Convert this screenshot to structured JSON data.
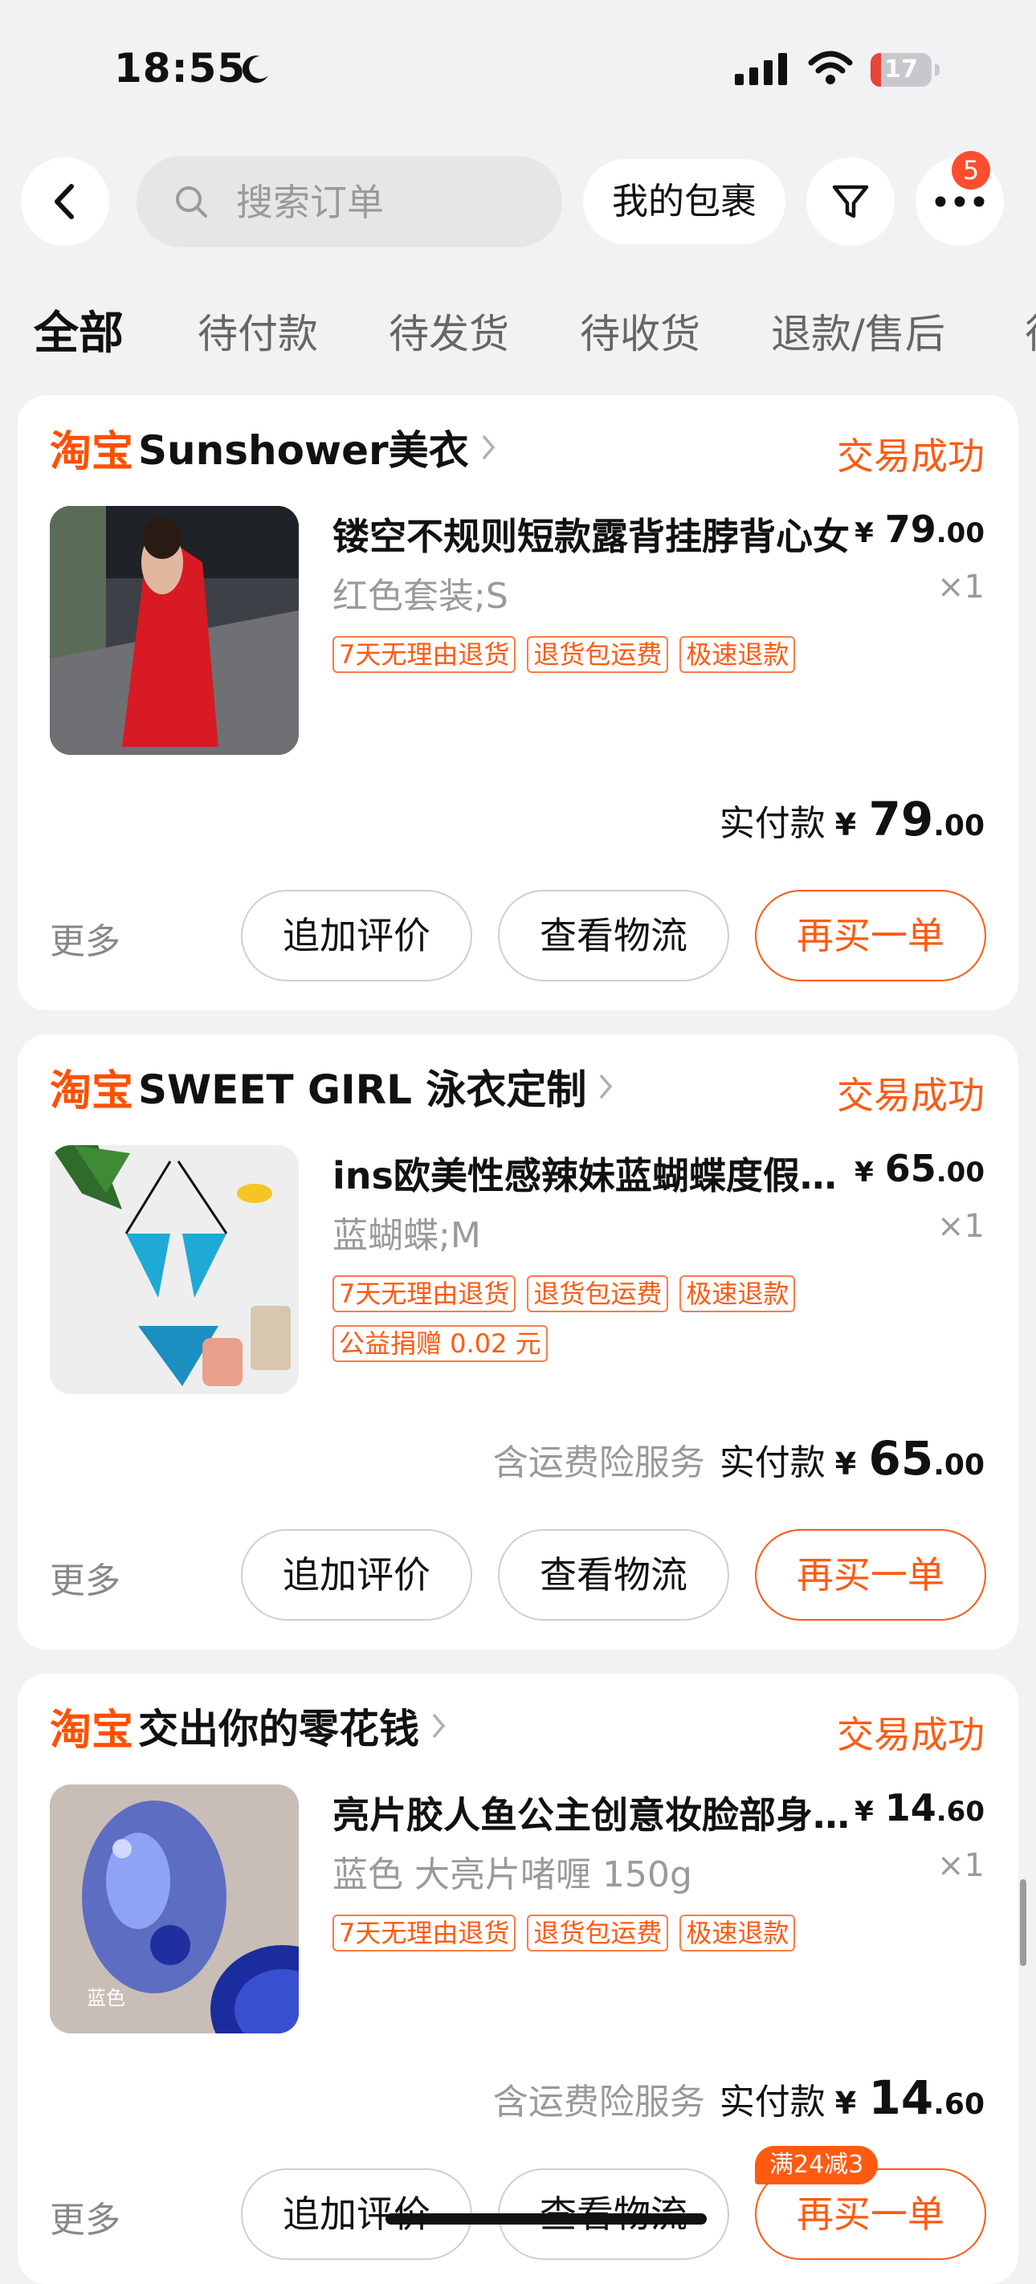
{
  "status_bar": {
    "time": "18:55",
    "battery": "17",
    "battery_level": 0.17,
    "battery_color": "#e8443a"
  },
  "nav": {
    "search_placeholder": "搜索订单",
    "package_label": "我的包裹",
    "more_badge": "5"
  },
  "tabs": [
    {
      "label": "全部",
      "active": true
    },
    {
      "label": "待付款"
    },
    {
      "label": "待发货"
    },
    {
      "label": "待收货"
    },
    {
      "label": "退款/售后"
    },
    {
      "label": "待评价"
    }
  ],
  "colors": {
    "accent": "#ff5a12",
    "brand": "#ff5000"
  },
  "orders": [
    {
      "platform": "淘宝",
      "shop": "Sunshower美衣",
      "status": "交易成功",
      "product_title": "镂空不规则短款露背挂脖背心女",
      "price": {
        "yen": "¥",
        "int": "79",
        "dec": ".00"
      },
      "variant": "红色套装;S",
      "qty": "×1",
      "tags": [
        "7天无理由退货",
        "退货包运费",
        "极速退款"
      ],
      "paid_extra": "",
      "paid_label": "实付款",
      "paid": {
        "yen": "¥",
        "int": "79",
        "dec": ".00"
      },
      "more": "更多",
      "btn_review": "追加评价",
      "btn_logistics": "查看物流",
      "btn_rebuy": "再买一单"
    },
    {
      "platform": "淘宝",
      "shop": "SWEET GIRL 泳衣定制",
      "status": "交易成功",
      "product_title": "ins欧美性感辣妹蓝蝴蝶度假比基尼",
      "price": {
        "yen": "¥",
        "int": "65",
        "dec": ".00"
      },
      "variant": "蓝蝴蝶;M",
      "qty": "×1",
      "tags": [
        "7天无理由退货",
        "退货包运费",
        "极速退款",
        "公益捐赠 0.02 元"
      ],
      "paid_extra": "含运费险服务",
      "paid_label": "实付款",
      "paid": {
        "yen": "¥",
        "int": "65",
        "dec": ".00"
      },
      "more": "更多",
      "btn_review": "追加评价",
      "btn_logistics": "查看物流",
      "btn_rebuy": "再买一单"
    },
    {
      "platform": "淘宝",
      "shop": "交出你的零花钱",
      "status": "交易成功",
      "product_title": "亮片胶人鱼公主创意妆脸部身体闪片",
      "price": {
        "yen": "¥",
        "int": "14",
        "dec": ".60"
      },
      "variant": "蓝色 大亮片啫喱 150g",
      "qty": "×1",
      "tags": [
        "7天无理由退货",
        "退货包运费",
        "极速退款"
      ],
      "thumb_label": "蓝色",
      "paid_extra": "含运费险服务",
      "paid_label": "实付款",
      "paid": {
        "yen": "¥",
        "int": "14",
        "dec": ".60"
      },
      "more": "更多",
      "btn_review": "追加评价",
      "btn_logistics": "查看物流",
      "btn_rebuy": "再买一单",
      "promo_badge": "满24减3"
    }
  ]
}
